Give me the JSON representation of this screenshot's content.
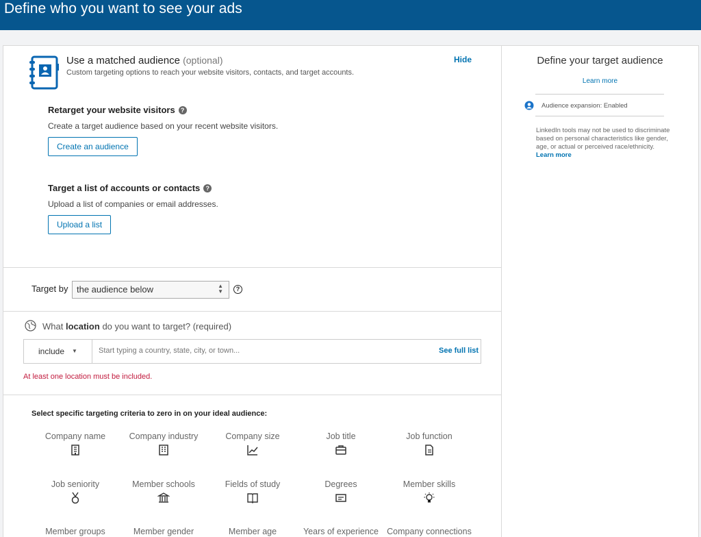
{
  "header": {
    "title": "Define who you want to see your ads"
  },
  "matched_audience": {
    "title": "Use a matched audience",
    "optional": "(optional)",
    "subtitle": "Custom targeting options to reach your website visitors, contacts, and target accounts.",
    "hide_label": "Hide",
    "retarget": {
      "heading": "Retarget your website visitors",
      "description": "Create a target audience based on your recent website visitors.",
      "button": "Create an audience"
    },
    "list": {
      "heading": "Target a list of accounts or contacts",
      "description": "Upload a list of companies or email addresses.",
      "button": "Upload a list"
    }
  },
  "target_by": {
    "label": "Target by",
    "selected": "the audience below"
  },
  "location": {
    "question_prefix": "What",
    "question_bold": "location",
    "question_suffix": "do you want to target? (required)",
    "mode": "include",
    "placeholder": "Start typing a country, state, city, or town...",
    "see_full_list": "See full list",
    "error": "At least one location must be included."
  },
  "criteria": {
    "title": "Select specific targeting criteria to zero in on your ideal audience:",
    "items": [
      {
        "label": "Company name",
        "icon": "building-icon"
      },
      {
        "label": "Company industry",
        "icon": "industry-icon"
      },
      {
        "label": "Company size",
        "icon": "chart-icon"
      },
      {
        "label": "Job title",
        "icon": "briefcase-icon"
      },
      {
        "label": "Job function",
        "icon": "document-icon"
      },
      {
        "label": "Job seniority",
        "icon": "medal-icon"
      },
      {
        "label": "Member schools",
        "icon": "school-icon"
      },
      {
        "label": "Fields of study",
        "icon": "book-icon"
      },
      {
        "label": "Degrees",
        "icon": "degree-icon"
      },
      {
        "label": "Member skills",
        "icon": "lightbulb-icon"
      },
      {
        "label": "Member groups",
        "icon": "groups-icon"
      },
      {
        "label": "Member gender",
        "icon": "gender-icon"
      },
      {
        "label": "Member age",
        "icon": "age-icon"
      },
      {
        "label": "Years of experience",
        "icon": "experience-icon"
      },
      {
        "label": "Company connections",
        "icon": "connections-icon"
      }
    ]
  },
  "sidebar": {
    "title": "Define your target audience",
    "learn_more": "Learn more",
    "expansion": "Audience expansion:  Enabled",
    "note": "LinkedIn tools may not be used to discriminate based on personal characteristics like gender, age, or actual or perceived race/ethnicity.",
    "note_link": "Learn more"
  },
  "colors": {
    "header": "#06568e",
    "link": "#0073b1",
    "error": "#c11a3d"
  }
}
